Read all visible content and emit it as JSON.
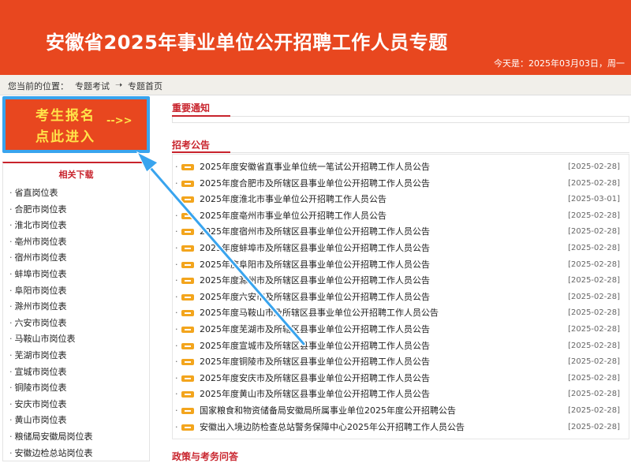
{
  "banner": {
    "title": "安徽省2025年事业单位公开招聘工作人员专题",
    "date": "今天是：2025年03月03日，周一"
  },
  "breadcrumb": {
    "prefix": "您当前的位置：",
    "item1": "专题考试",
    "sep": "➝",
    "item2": "专题首页"
  },
  "enroll": {
    "line1": "考生报名",
    "line2": "点此进入",
    "arrow": "-->>"
  },
  "downloads": {
    "title": "相关下载",
    "items": [
      "省直岗位表",
      "合肥市岗位表",
      "淮北市岗位表",
      "亳州市岗位表",
      "宿州市岗位表",
      "蚌埠市岗位表",
      "阜阳市岗位表",
      "滁州市岗位表",
      "六安市岗位表",
      "马鞍山市岗位表",
      "芜湖市岗位表",
      "宣城市岗位表",
      "铜陵市岗位表",
      "安庆市岗位表",
      "黄山市岗位表",
      "粮储局安徽局岗位表",
      "安徽边检总站岗位表"
    ]
  },
  "notices": {
    "title": "重要通知"
  },
  "announcements": {
    "title": "招考公告",
    "items": [
      {
        "text": "2025年度安徽省直事业单位统一笔试公开招聘工作人员公告",
        "date": "[2025-02-28]"
      },
      {
        "text": "2025年度合肥市及所辖区县事业单位公开招聘工作人员公告",
        "date": "[2025-02-28]"
      },
      {
        "text": "2025年度淮北市事业单位公开招聘工作人员公告",
        "date": "[2025-03-01]"
      },
      {
        "text": "2025年度亳州市事业单位公开招聘工作人员公告",
        "date": "[2025-02-28]"
      },
      {
        "text": "2025年度宿州市及所辖区县事业单位公开招聘工作人员公告",
        "date": "[2025-02-28]"
      },
      {
        "text": "2025年度蚌埠市及所辖区县事业单位公开招聘工作人员公告",
        "date": "[2025-02-28]"
      },
      {
        "text": "2025年度阜阳市及所辖区县事业单位公开招聘工作人员公告",
        "date": "[2025-02-28]"
      },
      {
        "text": "2025年度滁州市及所辖区县事业单位公开招聘工作人员公告",
        "date": "[2025-02-28]"
      },
      {
        "text": "2025年度六安市及所辖区县事业单位公开招聘工作人员公告",
        "date": "[2025-02-28]"
      },
      {
        "text": "2025年度马鞍山市及所辖区县事业单位公开招聘工作人员公告",
        "date": "[2025-02-28]"
      },
      {
        "text": "2025年度芜湖市及所辖区县事业单位公开招聘工作人员公告",
        "date": "[2025-02-28]"
      },
      {
        "text": "2025年度宣城市及所辖区县事业单位公开招聘工作人员公告",
        "date": "[2025-02-28]"
      },
      {
        "text": "2025年度铜陵市及所辖区县事业单位公开招聘工作人员公告",
        "date": "[2025-02-28]"
      },
      {
        "text": "2025年度安庆市及所辖区县事业单位公开招聘工作人员公告",
        "date": "[2025-02-28]"
      },
      {
        "text": "2025年度黄山市及所辖区县事业单位公开招聘工作人员公告",
        "date": "[2025-02-28]"
      },
      {
        "text": "国家粮食和物资储备局安徽局所属事业单位2025年度公开招聘公告",
        "date": "[2025-02-28]"
      },
      {
        "text": "安徽出入境边防检查总站警务保障中心2025年公开招聘工作人员公告",
        "date": "[2025-02-28]"
      }
    ]
  },
  "policy": {
    "title": "政策与考务问答"
  },
  "colors": {
    "brand": "#e8471f",
    "accent": "#c8232c",
    "highlight": "#39a4ee",
    "enroll_text": "#ffe44a"
  }
}
